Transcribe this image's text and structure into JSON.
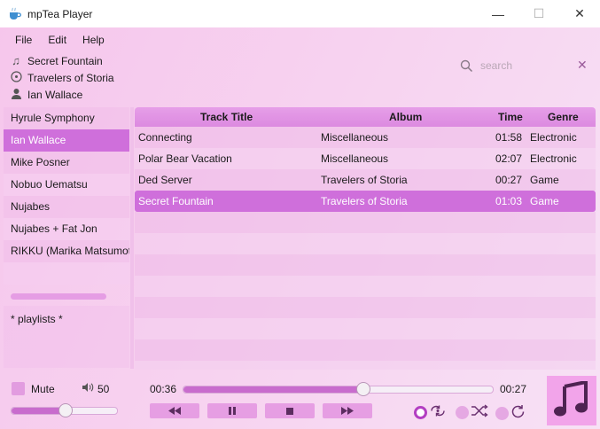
{
  "window": {
    "title": "mpTea Player",
    "minimize_label": "—",
    "maximize_label": "☐",
    "close_label": "✕"
  },
  "menu": [
    "File",
    "Edit",
    "Help"
  ],
  "now_playing": {
    "track": "Secret Fountain",
    "album": "Travelers of Storia",
    "artist": "Ian Wallace"
  },
  "search": {
    "placeholder": "search",
    "value": "",
    "clear_label": "✕"
  },
  "artists": {
    "items": [
      "Hyrule Symphony",
      "Ian Wallace",
      "Mike Posner",
      "Nobuo Uematsu",
      "Nujabes",
      "Nujabes + Fat Jon",
      "RIKKU (Marika Matsumoto)"
    ],
    "selected_index": 1
  },
  "playlists": {
    "label": "* playlists *"
  },
  "tracks": {
    "columns": {
      "title": "Track Title",
      "album": "Album",
      "time": "Time",
      "genre": "Genre"
    },
    "rows": [
      {
        "title": "Connecting",
        "album": "Miscellaneous",
        "time": "01:58",
        "genre": "Electronic"
      },
      {
        "title": "Polar Bear Vacation",
        "album": "Miscellaneous",
        "time": "02:07",
        "genre": "Electronic"
      },
      {
        "title": "Ded Server",
        "album": "Travelers of Storia",
        "time": "00:27",
        "genre": "Game"
      },
      {
        "title": "Secret Fountain",
        "album": "Travelers of Storia",
        "time": "01:03",
        "genre": "Game"
      }
    ],
    "selected_index": 3
  },
  "player": {
    "mute_label": "Mute",
    "volume": "50",
    "volume_fraction": 0.5,
    "current_time": "00:36",
    "total_time": "00:27",
    "progress_fraction": 0.58,
    "buttons": [
      "previous-icon",
      "pause-icon",
      "stop-icon",
      "next-icon"
    ],
    "toggles": [
      {
        "name": "repeat-icon",
        "on": true
      },
      {
        "name": "shuffle-icon",
        "on": false
      },
      {
        "name": "loop-icon",
        "on": false
      }
    ]
  },
  "colors": {
    "accent": "#cf6fdb",
    "header": "#e197e5",
    "button": "#e69ee3",
    "slider_fill": "#c86ccd"
  }
}
